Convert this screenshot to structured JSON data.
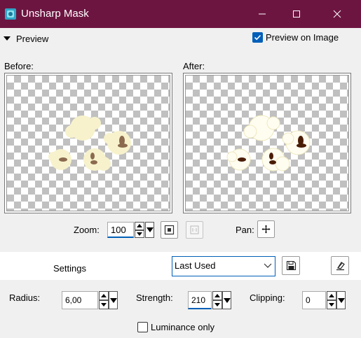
{
  "window": {
    "title": "Unsharp Mask"
  },
  "preview": {
    "toggle_label": "Preview",
    "preview_on_image_label": "Preview on Image",
    "preview_on_image_checked": true
  },
  "views": {
    "before_label": "Before:",
    "after_label": "After:"
  },
  "zoom": {
    "label": "Zoom:",
    "value": "100"
  },
  "pan": {
    "label": "Pan:"
  },
  "settings": {
    "label": "Settings",
    "preset_value": "Last Used"
  },
  "params": {
    "radius_label": "Radius:",
    "radius_value": "6,00",
    "strength_label": "Strength:",
    "strength_value": "210",
    "clipping_label": "Clipping:",
    "clipping_value": "0"
  },
  "luminance": {
    "label": "Luminance only",
    "checked": false
  },
  "colors": {
    "titlebar": "#6d1541",
    "accent": "#005fb8",
    "popcorn": "#f7f2cc",
    "kernel_before": "#8b6a4f",
    "kernel_after": "#4a1d07"
  }
}
